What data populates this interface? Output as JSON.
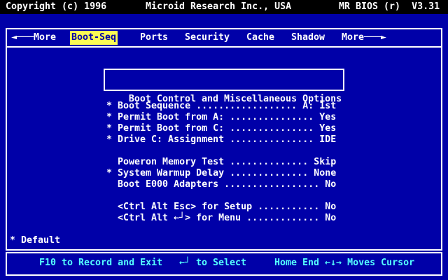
{
  "titlebar": {
    "copyright": "Copyright (c) 1996",
    "company": "Microid Research Inc., USA",
    "bios_version": "MR BIOS (r)  V3.31"
  },
  "menu": {
    "selected": "Boot-Seq",
    "items": [
      {
        "label": "◄───More"
      },
      {
        "label": "Boot-Seq"
      },
      {
        "label": "Ports"
      },
      {
        "label": "Security"
      },
      {
        "label": "Cache"
      },
      {
        "label": "Shadow"
      },
      {
        "label": "More───►"
      }
    ]
  },
  "panel": {
    "title": "Boot Control and Miscellaneous Options",
    "rows": [
      "* Boot Sequence .................. A: 1st",
      "* Permit Boot from A: ............... Yes",
      "* Permit Boot from C: ............... Yes",
      "* Drive C: Assignment ............... IDE",
      "  Poweron Memory Test .............. Skip",
      "* System Warmup Delay .............. None",
      "  Boot E000 Adapters ................. No",
      "  <Ctrl Alt Esc> for Setup ........... No",
      "  <Ctrl Alt ←┘> for Menu ............. No"
    ],
    "default_note": "* Default"
  },
  "footer": {
    "record": "F10 to Record and Exit",
    "select": "←┘ to Select",
    "cursor": "Home End ←↓→ Moves Cursor"
  },
  "colors": {
    "background": "#0000A8",
    "topbar_bg": "#000000",
    "text": "#FFFFFF",
    "footer_text": "#55FFFF",
    "highlight_bg": "#FCFC54",
    "highlight_text": "#0000A8",
    "border": "#FFFFFF"
  }
}
